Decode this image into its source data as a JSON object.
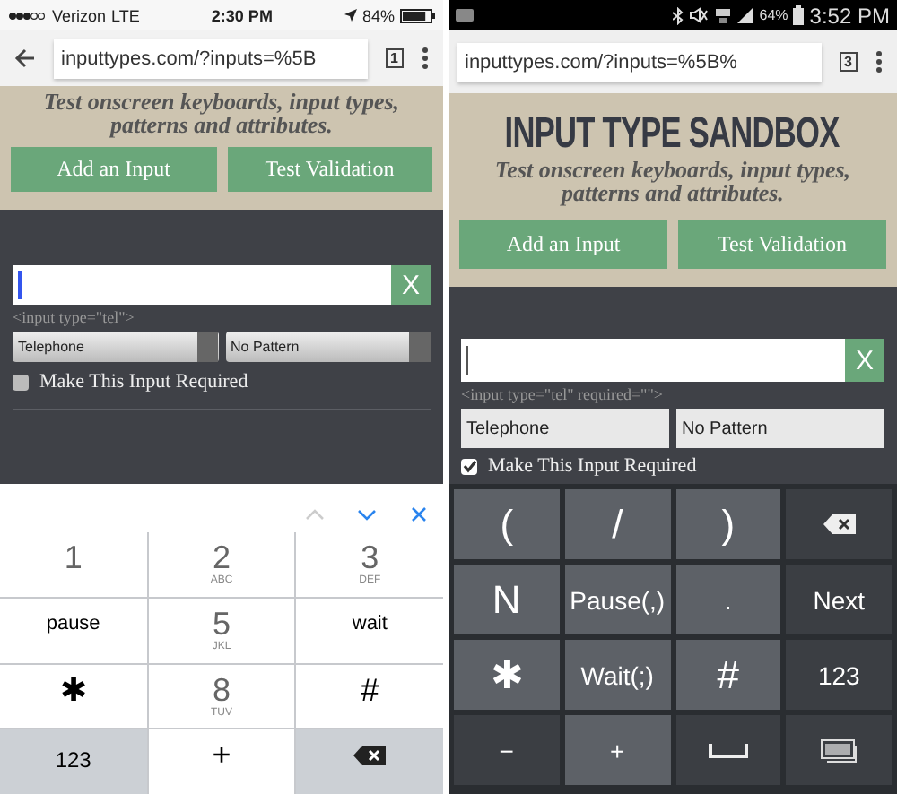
{
  "phones": [
    {
      "kind": "ios",
      "status_bar": {
        "carrier": "Verizon",
        "network": "LTE",
        "time": "2:30 PM",
        "battery": "84%"
      },
      "browser": {
        "url": "inputtypes.com/?inputs=%5B",
        "tab_count": "1"
      },
      "tagline": "Test onscreen keyboards, input types, patterns and attributes.",
      "buttons": [
        "Add an Input",
        "Test Validation"
      ],
      "input": {
        "remove_label": "X",
        "code": "<input type=\"tel\">"
      },
      "selects": [
        "Telephone",
        "No Pattern"
      ],
      "required": {
        "label": "Make This Input Required",
        "checked": false
      },
      "toolbar": [
        {
          "kind": "up",
          "disabled": true
        },
        {
          "kind": "down",
          "disabled": false
        },
        {
          "kind": "close",
          "disabled": false
        }
      ],
      "keys": [
        {
          "kind": "digit",
          "label": "1"
        },
        {
          "kind": "digit",
          "label": "2",
          "letters": "ABC"
        },
        {
          "kind": "digit",
          "label": "3",
          "letters": "DEF"
        },
        {
          "kind": "text",
          "label": "pause"
        },
        {
          "kind": "digit",
          "label": "5",
          "letters": "JKL"
        },
        {
          "kind": "text",
          "label": "wait"
        },
        {
          "kind": "symbol",
          "label": "✱"
        },
        {
          "kind": "digit",
          "label": "8",
          "letters": "TUV"
        },
        {
          "kind": "symbol",
          "label": "#"
        },
        {
          "kind": "function",
          "label": "123"
        },
        {
          "kind": "symbol",
          "label": "+"
        },
        {
          "kind": "backspace"
        }
      ]
    },
    {
      "kind": "android",
      "status_bar": {
        "time": "3:52 PM",
        "battery": "64%"
      },
      "browser": {
        "url": "inputtypes.com/?inputs=%5B%",
        "tab_count": "3"
      },
      "title": "INPUT TYPE SANDBOX",
      "tagline": "Test onscreen keyboards, input types, patterns and attributes.",
      "buttons": [
        "Add an Input",
        "Test Validation"
      ],
      "input": {
        "remove_label": "X",
        "code": "<input type=\"tel\" required=\"\">"
      },
      "selects": [
        "Telephone",
        "No Pattern"
      ],
      "required": {
        "label": "Make This Input Required",
        "checked": true
      },
      "keys": [
        {
          "kind": "light",
          "label": "("
        },
        {
          "kind": "light",
          "label": "/"
        },
        {
          "kind": "light",
          "label": ")"
        },
        {
          "kind": "backspace"
        },
        {
          "kind": "light",
          "label": "N"
        },
        {
          "kind": "light",
          "label": "Pause(,)"
        },
        {
          "kind": "light",
          "label": "."
        },
        {
          "kind": "dark",
          "label": "Next"
        },
        {
          "kind": "light",
          "label": "✱"
        },
        {
          "kind": "light",
          "label": "Wait(;)"
        },
        {
          "kind": "light",
          "label": "#"
        },
        {
          "kind": "dark",
          "label": "123"
        },
        {
          "kind": "dark",
          "label": "−"
        },
        {
          "kind": "light",
          "label": "+"
        },
        {
          "kind": "space"
        },
        {
          "kind": "keyboard"
        }
      ]
    }
  ]
}
